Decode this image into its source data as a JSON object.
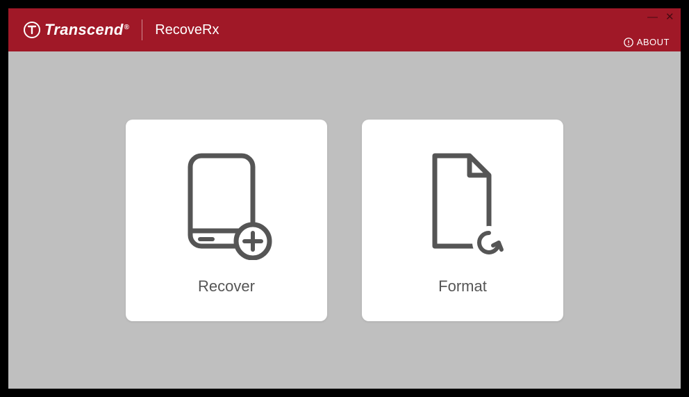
{
  "brand": {
    "name": "Transcend",
    "registered": "®"
  },
  "app": {
    "name": "RecoveRx"
  },
  "header": {
    "about_label": "ABOUT"
  },
  "tiles": {
    "recover": {
      "label": "Recover"
    },
    "format": {
      "label": "Format"
    }
  },
  "window_controls": {
    "minimize": "—",
    "close": "✕"
  },
  "colors": {
    "brand_bg": "#a01827",
    "content_bg": "#bfbfbf",
    "icon_stroke": "#555"
  }
}
